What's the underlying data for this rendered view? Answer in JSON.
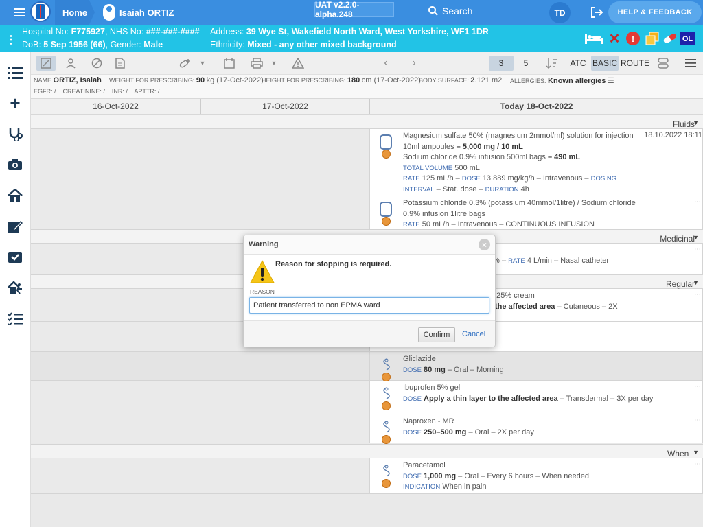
{
  "topbar": {
    "home_label": "Home",
    "patient_name": "Isaiah ORTIZ",
    "version": "UAT v2.2.0-alpha.248",
    "search_label": "Search",
    "user_initials": "TD",
    "help_label": "HELP & FEEDBACK"
  },
  "banner": {
    "hospital_no_label": "Hospital No:",
    "hospital_no": "F775927",
    "nhs_no_label": "NHS No:",
    "nhs_no": "###-###-####",
    "address_label": "Address:",
    "address": "39 Wye St, Wakefield North Ward, West Yorkshire, WF1 1DR",
    "dob_label": "DoB:",
    "dob": "5 Sep 1956 (66)",
    "gender_label": "Gender:",
    "gender": "Male",
    "ethnicity_label": "Ethnicity:",
    "ethnicity": "Mixed - any other mixed background",
    "status_ol": "OL"
  },
  "toolbar": {
    "view_num_a": "3",
    "view_num_b": "5",
    "atc": "ATC",
    "basic": "BASIC",
    "route": "ROUTE"
  },
  "info": {
    "name_label": "NAME",
    "name": "ORTIZ, Isaiah",
    "weight_label": "WEIGHT FOR PRESCRIBING:",
    "weight": "90",
    "weight_unit": "kg (17-Oct-2022)",
    "height_label": "HEIGHT FOR PRESCRIBING:",
    "height": "180",
    "height_unit": "cm (17-Oct-2022)",
    "bsa_label": "BODY SURFACE:",
    "bsa": "2",
    "bsa_unit": ".121 m2",
    "allergies_label": "ALLERGIES:",
    "allergies": "Known allergies",
    "egfr": "EGFR: /",
    "creatinine": "CREATININE: /",
    "inr": "INR: /",
    "apttr": "APTTR: /"
  },
  "dates": [
    "16-Oct-2022",
    "17-Oct-2022",
    "Today 18-Oct-2022"
  ],
  "sections": {
    "fluids": "Fluids",
    "gases": "Medicinal gases",
    "regular": "Regular",
    "when_needed": "When needed"
  },
  "meds": {
    "mg_name": "Magnesium sulfate 50% (magnesium 2mmol/ml) solution for injection 10ml ampoules",
    "mg_dose": "– 5,000 mg / 10 mL",
    "mg_date": "18.10.2022 18:11",
    "nacl_name": "Sodium chloride 0.9% infusion 500ml bags",
    "nacl_dose": "– 490 mL",
    "total_volume_label": "TOTAL VOLUME",
    "total_volume": "500 mL",
    "rate_label": "RATE",
    "rate1": "125 mL/h –",
    "dose_label": "DOSE",
    "dose1": "13.889 mg/kg/h – Intravenous –",
    "dosing_interval_label": "DOSING INTERVAL",
    "interval1": "– Stat. dose –",
    "duration_label": "DURATION",
    "duration1": "4h",
    "kcl_name": "Potassium chloride 0.3% (potassium 40mmol/1litre) / Sodium chloride 0.9% infusion 1litre bags",
    "kcl_rate": "50 mL/h – Intravenous – CONTINUOUS INFUSION",
    "gas_partial": "3% –",
    "gas_rate": "4 L/min – Nasal catheter",
    "cream_partial": "025% cream",
    "cream_dose": "the affected area",
    "cream_rest": "– Cutaneous – 2X",
    "partial_g": "g",
    "gliclazide": "Gliclazide",
    "gliclazide_dose": "80 mg",
    "gliclazide_rest": "– Oral – Morning",
    "ibuprofen": "Ibuprofen 5% gel",
    "ibuprofen_dose": "Apply a thin layer to the affected area",
    "ibuprofen_rest": "– Transdermal – 3X per day",
    "naproxen": "Naproxen - MR",
    "naproxen_dose": "250–500 mg",
    "naproxen_rest": "– Oral – 2X per day",
    "paracetamol": "Paracetamol",
    "paracetamol_dose": "1,000 mg",
    "paracetamol_rest": "– Oral – Every 6 hours – When needed",
    "indication_label": "INDICATION",
    "indication": "When in pain"
  },
  "dialog": {
    "title": "Warning",
    "message": "Reason for stopping is required.",
    "reason_label": "REASON",
    "reason_value": "Patient transferred to non EPMA ward",
    "confirm": "Confirm",
    "cancel": "Cancel"
  },
  "icons": {
    "accent": "#3a8ee0",
    "banner": "#22c3e6",
    "warning": "#f5c518"
  }
}
